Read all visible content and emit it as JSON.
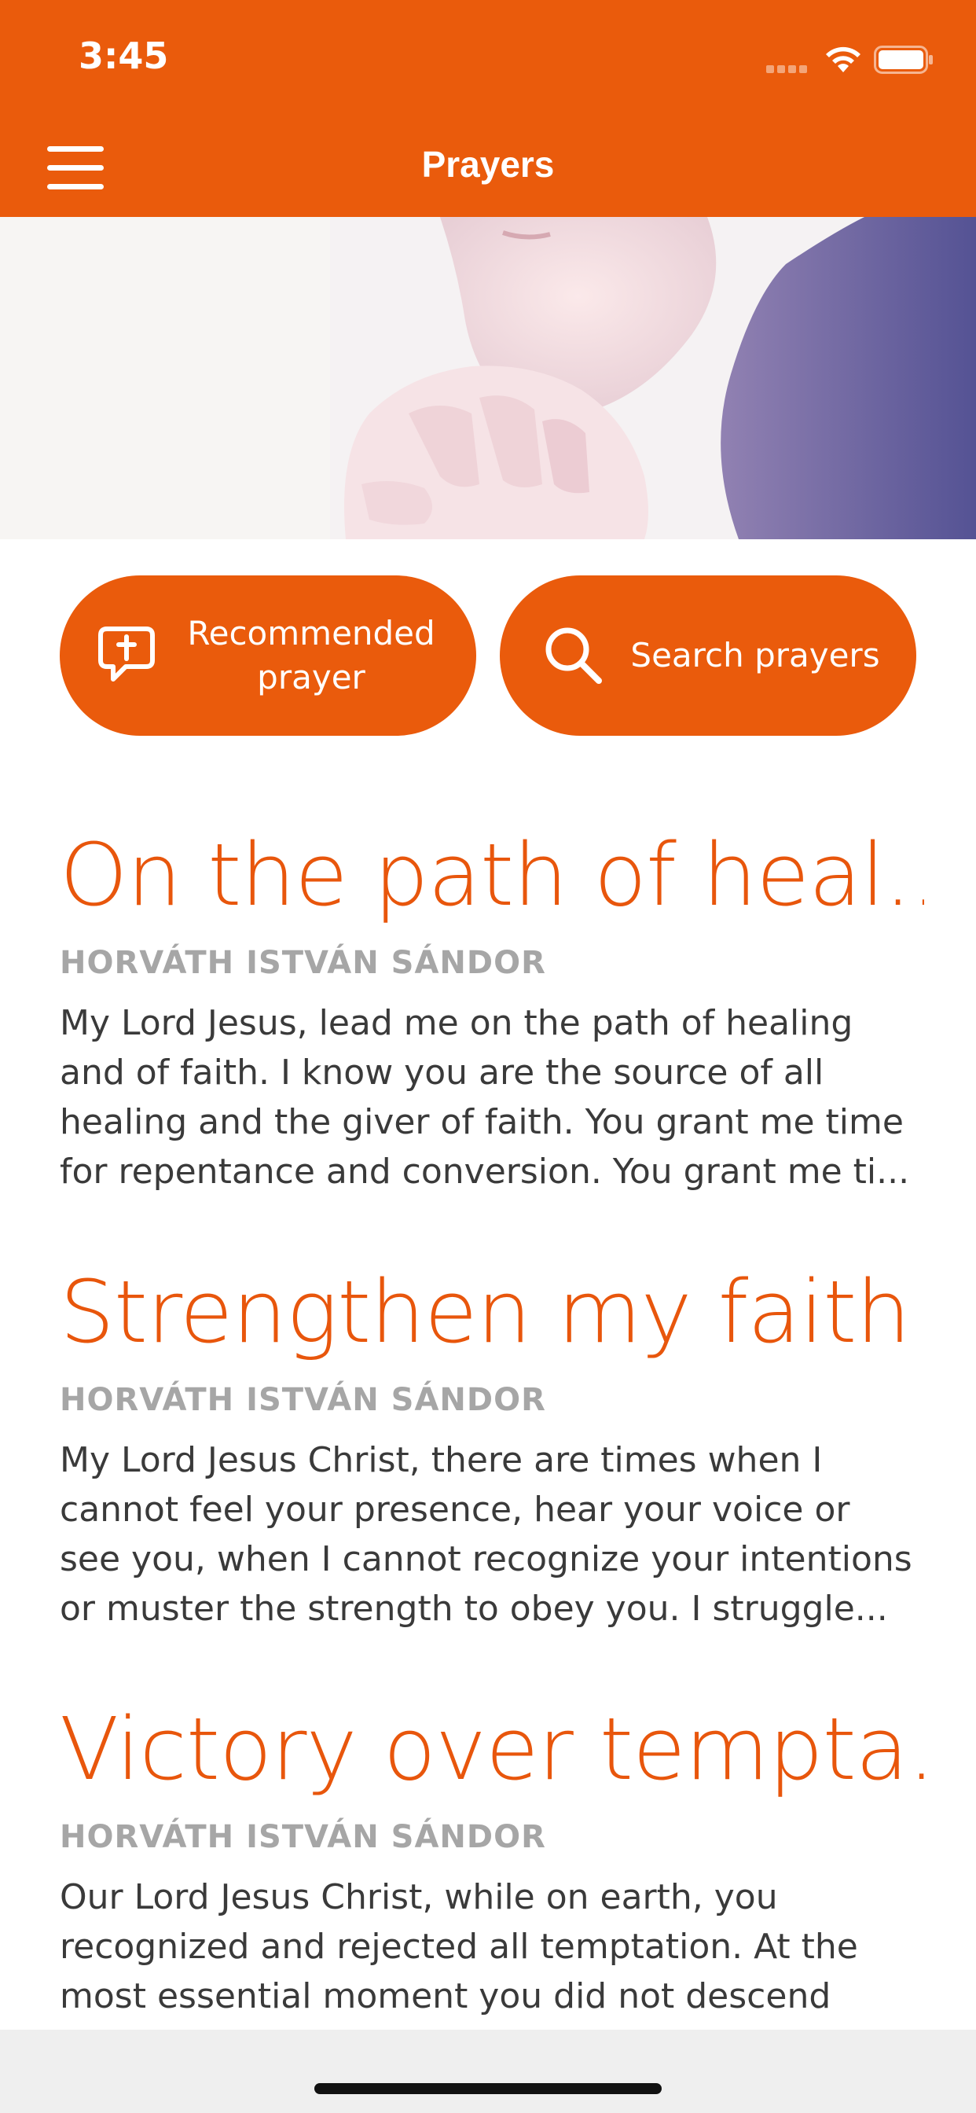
{
  "status_bar": {
    "time": "3:45"
  },
  "app_bar": {
    "title": "Prayers"
  },
  "actions": {
    "recommended_label_line1": "Recommended",
    "recommended_label_line2": "prayer",
    "search_label": "Search prayers"
  },
  "prayers": [
    {
      "title": "On the path of heal...",
      "author": "HORVÁTH ISTVÁN SÁNDOR",
      "excerpt_lines": [
        "My Lord Jesus, lead me on the path of healing",
        "and of faith. I know you are the source of all",
        "healing and the giver of faith. You grant me time",
        "for repentance and conversion. You grant me ti..."
      ]
    },
    {
      "title": "Strengthen my faith!",
      "author": "HORVÁTH ISTVÁN SÁNDOR",
      "excerpt_lines": [
        "My Lord Jesus Christ, there are times when I",
        "cannot feel your presence, hear your voice or",
        "see you, when I cannot recognize your intentions",
        "or muster the strength to obey you. I struggle..."
      ]
    },
    {
      "title": "Victory over tempta...",
      "author": "HORVÁTH ISTVÁN SÁNDOR",
      "excerpt_lines": [
        "Our Lord Jesus Christ, while on earth, you",
        "recognized and rejected all temptation. At the",
        "most essential moment you did not descend"
      ]
    }
  ],
  "colors": {
    "accent": "#EA5B0C",
    "author_gray": "#a6a6a6",
    "body_text": "#3a3a3a"
  },
  "icons": {
    "menu": "hamburger-icon",
    "recommended": "chat-cross-icon",
    "search": "search-icon",
    "wifi": "wifi-icon",
    "battery": "battery-icon",
    "signal": "cellular-signal-icon"
  }
}
